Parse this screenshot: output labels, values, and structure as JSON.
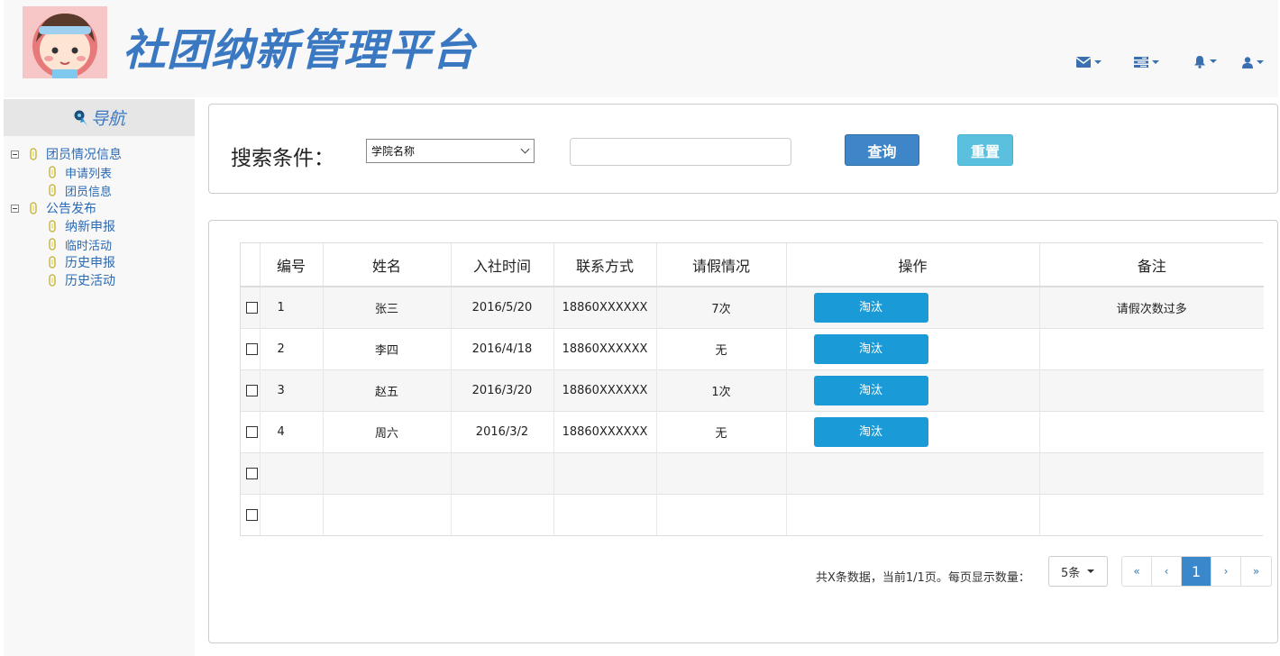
{
  "header": {
    "title": "社团纳新管理平台",
    "icons": [
      "envelope-icon",
      "tasks-icon",
      "bell-icon",
      "user-icon"
    ]
  },
  "sidebar": {
    "nav_title": "导航",
    "tree": [
      {
        "label": "团员情况信息",
        "children": [
          "申请列表",
          "团员信息"
        ]
      },
      {
        "label": "公告发布",
        "children": [
          "纳新申报",
          "临时活动",
          "历史申报",
          "历史活动"
        ]
      }
    ]
  },
  "search": {
    "label": "搜索条件：",
    "select_value": "学院名称",
    "input_value": "",
    "query_label": "查询",
    "reset_label": "重置"
  },
  "table": {
    "headers": [
      "编号",
      "姓名",
      "入社时间",
      "联系方式",
      "请假情况",
      "操作",
      "备注"
    ],
    "action_label": "淘汰",
    "rows": [
      {
        "id": "1",
        "name": "张三",
        "join_date": "2016/5/20",
        "contact": "18860XXXXXX",
        "leave": "7次",
        "note": "请假次数过多"
      },
      {
        "id": "2",
        "name": "李四",
        "join_date": "2016/4/18",
        "contact": "18860XXXXXX",
        "leave": "无",
        "note": ""
      },
      {
        "id": "3",
        "name": "赵五",
        "join_date": "2016/3/20",
        "contact": "18860XXXXXX",
        "leave": "1次",
        "note": ""
      },
      {
        "id": "4",
        "name": "周六",
        "join_date": "2016/3/2",
        "contact": "18860XXXXXX",
        "leave": "无",
        "note": ""
      }
    ],
    "empty_rows": 2
  },
  "pagination": {
    "summary": "共X条数据，当前1/1页。每页显示数量：",
    "page_size": "5条",
    "first": "«",
    "prev": "‹",
    "current": "1",
    "next": "›",
    "last": "»"
  },
  "colors": {
    "brand": "#3a78c2",
    "primary_button": "#3f86c9",
    "info_button": "#5bc0de",
    "action_button": "#1a9bd8"
  }
}
